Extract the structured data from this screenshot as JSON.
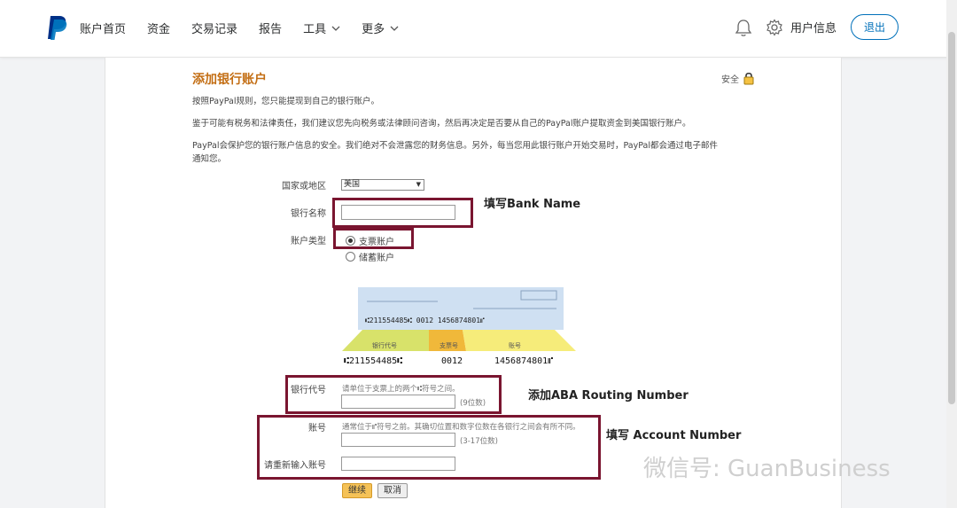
{
  "nav": {
    "items": [
      {
        "label": "账户首页"
      },
      {
        "label": "资金"
      },
      {
        "label": "交易记录"
      },
      {
        "label": "报告"
      },
      {
        "label": "工具"
      },
      {
        "label": "更多"
      }
    ],
    "user_label": "用户信息",
    "logout_label": "退出"
  },
  "page": {
    "title": "添加银行账户",
    "secure_label": "安全",
    "para1": "按照PayPal规则，您只能提现到自己的银行账户。",
    "para2": "鉴于可能有税务和法律责任，我们建议您先向税务或法律顾问咨询，然后再决定是否要从自己的PayPal账户提取资金到美国银行账户。",
    "para3_line1": "PayPal会保护您的银行账户信息的安全。我们绝对不会泄露您的财务信息。另外，每当您用此银行账户开始交易时，PayPal都会通过电子邮件",
    "para3_line2": "通知您。"
  },
  "form": {
    "country_label": "国家或地区",
    "country_value": "美国",
    "bank_name_label": "银行名称",
    "account_type_label": "账户类型",
    "type_checking": "支票账户",
    "type_savings": "储蓄账户",
    "routing_label": "银行代号",
    "routing_hint": "请单位于支票上的两个⑆符号之间。",
    "routing_digits": "(9位数)",
    "account_label": "账号",
    "account_hint": "通常位于⑈符号之前。其确切位置和数字位数在各银行之间会有所不同。",
    "account_digits": "(3-17位数)",
    "reenter_label": "请重新输入账号",
    "continue_label": "继续",
    "cancel_label": "取消"
  },
  "cheque": {
    "micr_top": "⑆211554485⑆   0012   1456874801⑈",
    "label_routing": "银行代号",
    "label_check": "支票号",
    "label_account": "账号",
    "micr_routing": "⑆211554485⑆",
    "micr_check": "0012",
    "micr_account": "1456874801⑈"
  },
  "annotations": {
    "bank_name": "填写Bank Name",
    "routing": "添加ABA Routing Number",
    "account": "填写 Account Number"
  },
  "watermark": "微信号: GuanBusiness",
  "colors": {
    "accent": "#0070ba",
    "heading": "#c36e14",
    "annotation_box": "#7a1530",
    "cheque_routing": "#d8e26a",
    "cheque_check": "#f0b83a",
    "cheque_account": "#f6ec7a"
  }
}
